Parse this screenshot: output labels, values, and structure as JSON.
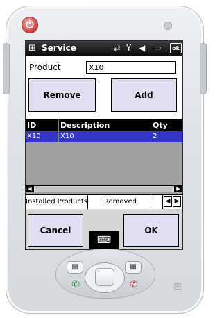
{
  "titlebar": {
    "title": "Service",
    "icons": [
      "windows-flag-icon",
      "connectivity-icon",
      "no-signal-icon",
      "volume-icon",
      "battery-icon"
    ],
    "ok_label": "ok"
  },
  "form": {
    "product_label": "Product",
    "product_value": "X10",
    "remove_label": "Remove",
    "add_label": "Add"
  },
  "grid": {
    "columns": [
      "ID",
      "Description",
      "Qty"
    ],
    "rows": [
      {
        "id": "X10",
        "description": "X10",
        "qty": "2"
      }
    ]
  },
  "tabs": {
    "items": [
      "Installed Products",
      "Removed Products"
    ],
    "active": "Removed Products"
  },
  "bottom": {
    "cancel_label": "Cancel",
    "ok_label": "OK"
  },
  "colors": {
    "button_bg": "#e0e0f2",
    "selection": "#3535c8",
    "grid_bg": "#a0a0a0",
    "bottom_bg": "#d6d6d6"
  }
}
